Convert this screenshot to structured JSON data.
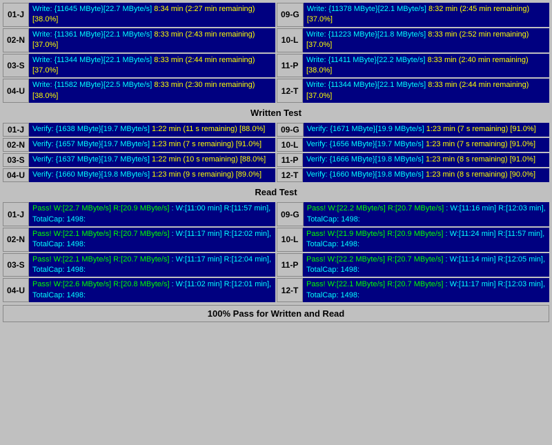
{
  "sections": {
    "write_test": {
      "label": "Written Test",
      "rows": [
        {
          "left_id": "01-J",
          "left_line1": "Write: {11645 MByte}[22.7 MByte/s]",
          "left_line2": "8:34 min (2:27 min remaining)  [38.0%]",
          "right_id": "09-G",
          "right_line1": "Write: {11378 MByte}[22.1 MByte/s]",
          "right_line2": "8:32 min (2:45 min remaining)  [37.0%]"
        },
        {
          "left_id": "02-N",
          "left_line1": "Write: {11361 MByte}[22.1 MByte/s]",
          "left_line2": "8:33 min (2:43 min remaining)  [37.0%]",
          "right_id": "10-L",
          "right_line1": "Write: {11223 MByte}[21.8 MByte/s]",
          "right_line2": "8:33 min (2:52 min remaining)  [37.0%]"
        },
        {
          "left_id": "03-S",
          "left_line1": "Write: {11344 MByte}[22.1 MByte/s]",
          "left_line2": "8:33 min (2:44 min remaining)  [37.0%]",
          "right_id": "11-P",
          "right_line1": "Write: {11411 MByte}[22.2 MByte/s]",
          "right_line2": "8:33 min (2:40 min remaining)  [38.0%]"
        },
        {
          "left_id": "04-U",
          "left_line1": "Write: {11582 MByte}[22.5 MByte/s]",
          "left_line2": "8:33 min (2:30 min remaining)  [38.0%]",
          "right_id": "12-T",
          "right_line1": "Write: {11344 MByte}[22.1 MByte/s]",
          "right_line2": "8:33 min (2:44 min remaining)  [37.0%]"
        }
      ]
    },
    "verify_test": {
      "label": "Written Test",
      "rows": [
        {
          "left_id": "01-J",
          "left_line1": "Verify: {1638 MByte}[19.7 MByte/s]",
          "left_line2": "1:22 min (11 s remaining)   [88.0%]",
          "right_id": "09-G",
          "right_line1": "Verify: {1671 MByte}[19.9 MByte/s]",
          "right_line2": "1:23 min (7 s remaining)   [91.0%]"
        },
        {
          "left_id": "02-N",
          "left_line1": "Verify: {1657 MByte}[19.7 MByte/s]",
          "left_line2": "1:23 min (7 s remaining)   [91.0%]",
          "right_id": "10-L",
          "right_line1": "Verify: {1656 MByte}[19.7 MByte/s]",
          "right_line2": "1:23 min (7 s remaining)   [91.0%]"
        },
        {
          "left_id": "03-S",
          "left_line1": "Verify: {1637 MByte}[19.7 MByte/s]",
          "left_line2": "1:22 min (10 s remaining)   [88.0%]",
          "right_id": "11-P",
          "right_line1": "Verify: {1666 MByte}[19.8 MByte/s]",
          "right_line2": "1:23 min (8 s remaining)   [91.0%]"
        },
        {
          "left_id": "04-U",
          "left_line1": "Verify: {1660 MByte}[19.8 MByte/s]",
          "left_line2": "1:23 min (9 s remaining)   [89.0%]",
          "right_id": "12-T",
          "right_line1": "Verify: {1660 MByte}[19.8 MByte/s]",
          "right_line2": "1:23 min (8 s remaining)   [90.0%]"
        }
      ]
    },
    "read_test": {
      "label": "Read Test",
      "rows": [
        {
          "left_id": "01-J",
          "left_line1": "Pass! W:[22.7 MByte/s] R:[20.9 MByte/s]",
          "left_line2": ": W:[11:00 min] R:[11:57 min], TotalCap: 1498:",
          "right_id": "09-G",
          "right_line1": "Pass! W:[22.2 MByte/s] R:[20.7 MByte/s]",
          "right_line2": ": W:[11:16 min] R:[12:03 min], TotalCap: 1498:"
        },
        {
          "left_id": "02-N",
          "left_line1": "Pass! W:[22.1 MByte/s] R:[20.7 MByte/s]",
          "left_line2": ": W:[11:17 min] R:[12:02 min], TotalCap: 1498:",
          "right_id": "10-L",
          "right_line1": "Pass! W:[21.9 MByte/s] R:[20.9 MByte/s]",
          "right_line2": ": W:[11:24 min] R:[11:57 min], TotalCap: 1498:"
        },
        {
          "left_id": "03-S",
          "left_line1": "Pass! W:[22.1 MByte/s] R:[20.7 MByte/s]",
          "left_line2": ": W:[11:17 min] R:[12:04 min], TotalCap: 1498:",
          "right_id": "11-P",
          "right_line1": "Pass! W:[22.2 MByte/s] R:[20.7 MByte/s]",
          "right_line2": ": W:[11:14 min] R:[12:05 min], TotalCap: 1498:"
        },
        {
          "left_id": "04-U",
          "left_line1": "Pass! W:[22.6 MByte/s] R:[20.8 MByte/s]",
          "left_line2": ": W:[11:02 min] R:[12:01 min], TotalCap: 1498:",
          "right_id": "12-T",
          "right_line1": "Pass! W:[22.1 MByte/s] R:[20.7 MByte/s]",
          "right_line2": ": W:[11:17 min] R:[12:03 min], TotalCap: 1498:"
        }
      ]
    }
  },
  "headers": {
    "write_section": "Written Test",
    "read_section": "Read Test",
    "footer": "100% Pass for Written and Read"
  }
}
